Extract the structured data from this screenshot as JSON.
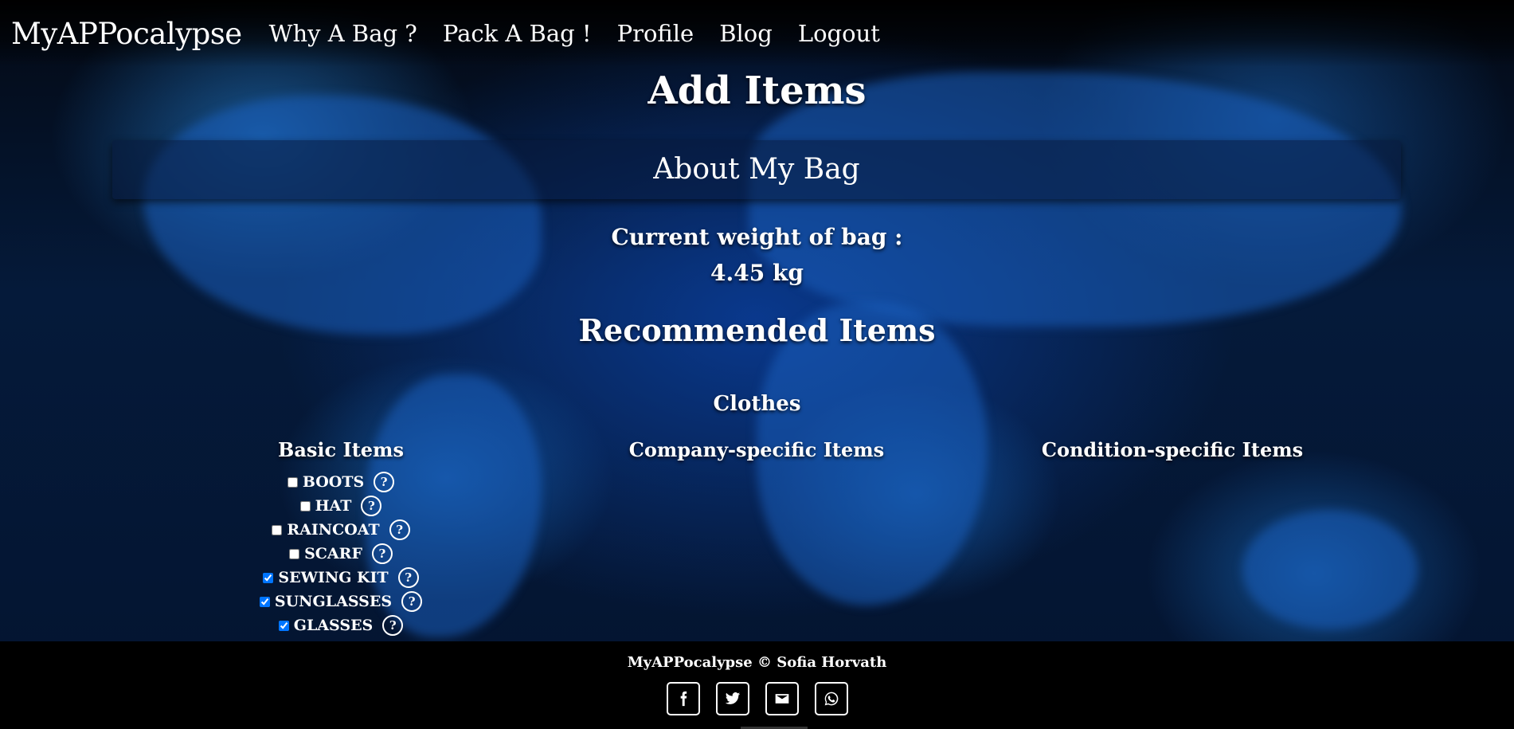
{
  "nav": {
    "brand": "MyAPPocalypse",
    "links": [
      "Why A Bag ?",
      "Pack A Bag !",
      "Profile",
      "Blog",
      "Logout"
    ]
  },
  "page_title": "Add Items",
  "about_title": "About My Bag",
  "weight": {
    "label": "Current weight of bag :",
    "value": "4.45 kg"
  },
  "recommended_title": "Recommended Items",
  "category": "Clothes",
  "columns": {
    "basic": "Basic Items",
    "company": "Company-specific Items",
    "condition": "Condition-specific Items"
  },
  "help_label": "?",
  "basic_items": [
    {
      "label": "BOOTS",
      "checked": false
    },
    {
      "label": "HAT",
      "checked": false
    },
    {
      "label": "RAINCOAT",
      "checked": false
    },
    {
      "label": "SCARF",
      "checked": false
    },
    {
      "label": "SEWING KIT",
      "checked": true
    },
    {
      "label": "SUNGLASSES",
      "checked": true
    },
    {
      "label": "GLASSES",
      "checked": true
    }
  ],
  "footer": {
    "text": "MyAPPocalypse © Sofia Horvath",
    "social_icons": [
      "facebook-icon",
      "twitter-icon",
      "email-icon",
      "whatsapp-icon"
    ]
  }
}
